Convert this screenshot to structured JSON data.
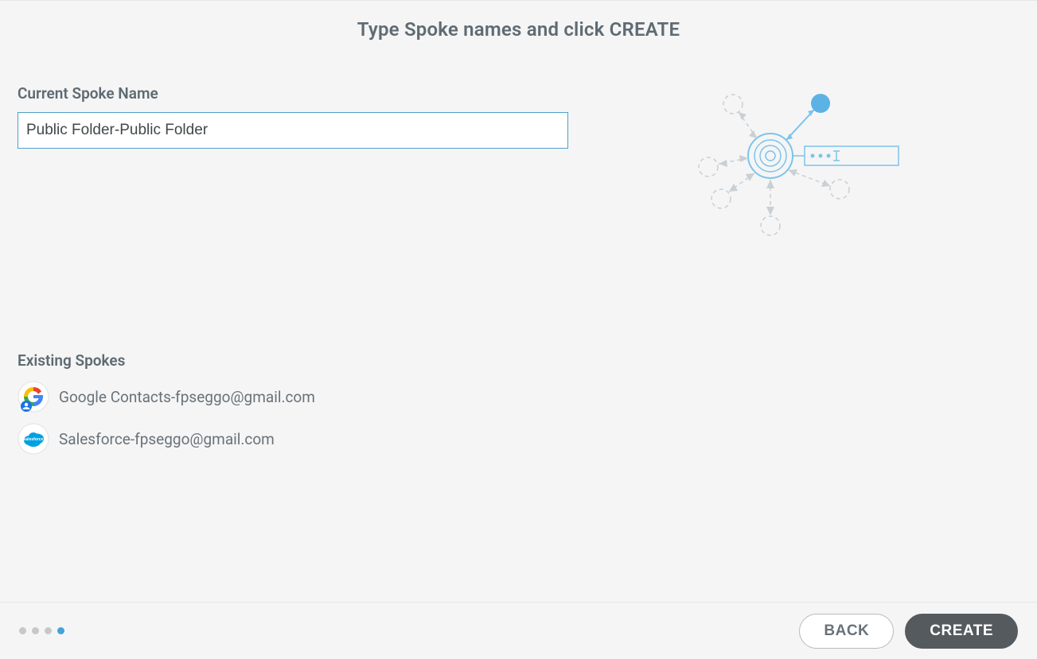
{
  "header": {
    "title": "Type Spoke names and click CREATE"
  },
  "form": {
    "current_spoke_label": "Current Spoke Name",
    "current_spoke_value": "Public Folder-Public Folder"
  },
  "existing": {
    "heading": "Existing Spokes",
    "items": [
      {
        "label": "Google Contacts-fpseggo@gmail.com"
      },
      {
        "label": "Salesforce-fpseggo@gmail.com"
      }
    ]
  },
  "footer": {
    "back_label": "BACK",
    "create_label": "CREATE",
    "step_count": 4,
    "active_step": 4
  },
  "colors": {
    "accent": "#46a3d8",
    "input_border": "#4ea1c9",
    "button_dark": "#555a5e"
  }
}
